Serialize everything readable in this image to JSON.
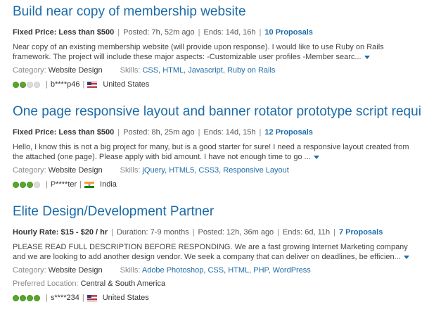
{
  "jobs": [
    {
      "title": "Build near copy of membership website",
      "type_label": "Fixed Price: Less than $500",
      "posted": "Posted: 7h, 52m ago",
      "ends": "Ends: 14d, 16h",
      "proposals": "10 Proposals",
      "description": "Near copy of an existing membership website (will provide upon response). I would like to use Ruby on Rails framework. The project will include these major aspects: -Customizable user profiles -Member searc...",
      "category_label": "Category:",
      "category": "Website Design",
      "skills_label": "Skills:",
      "skills": [
        "CSS",
        "HTML",
        "Javascript",
        "Ruby on Rails"
      ],
      "rating": 2,
      "rating_max": 4,
      "client": "b****p46",
      "flag_icon": "us-flag-icon",
      "country": "United States"
    },
    {
      "title": "One page responsive layout and banner rotator prototype script required",
      "type_label": "Fixed Price: Less than $500",
      "posted": "Posted: 8h, 25m ago",
      "ends": "Ends: 14d, 15h",
      "proposals": "12 Proposals",
      "description": "Hello, I know this is not a big project for many, but is a good starter for sure! I need a responsive layout created from the attached (one page). Please apply with bid amount. I have not enough time to go ...",
      "category_label": "Category:",
      "category": "Website Design",
      "skills_label": "Skills:",
      "skills": [
        "jQuery",
        "HTML5",
        "CSS3",
        "Responsive Layout"
      ],
      "rating": 3,
      "rating_max": 4,
      "client": "P****ter",
      "flag_icon": "india-flag-icon",
      "country": "India"
    },
    {
      "title": "Elite Design/Development Partner",
      "type_label": "Hourly Rate: $15 - $20 / hr",
      "duration": "Duration: 7-9 months",
      "posted": "Posted: 12h, 36m ago",
      "ends": "Ends: 6d, 11h",
      "proposals": "7 Proposals",
      "description": "PLEASE READ FULL DESCRIPTION BEFORE RESPONDING. We are a fast growing Internet Marketing company and we are looking to add another design vendor. We seek a company that can deliver on deadlines, be efficien...",
      "category_label": "Category:",
      "category": "Website Design",
      "skills_label": "Skills:",
      "skills": [
        "Adobe Photoshop",
        "CSS",
        "HTML",
        "PHP",
        "WordPress"
      ],
      "preferred_label": "Preferred Location:",
      "preferred": "Central & South America",
      "rating": 4,
      "rating_max": 4,
      "client": "s****234",
      "flag_icon": "us-flag-icon",
      "country": "United States"
    }
  ],
  "colors": {
    "link": "#1d6ba8",
    "rating_on": "#5aa52b",
    "rating_off": "#dddddd"
  }
}
